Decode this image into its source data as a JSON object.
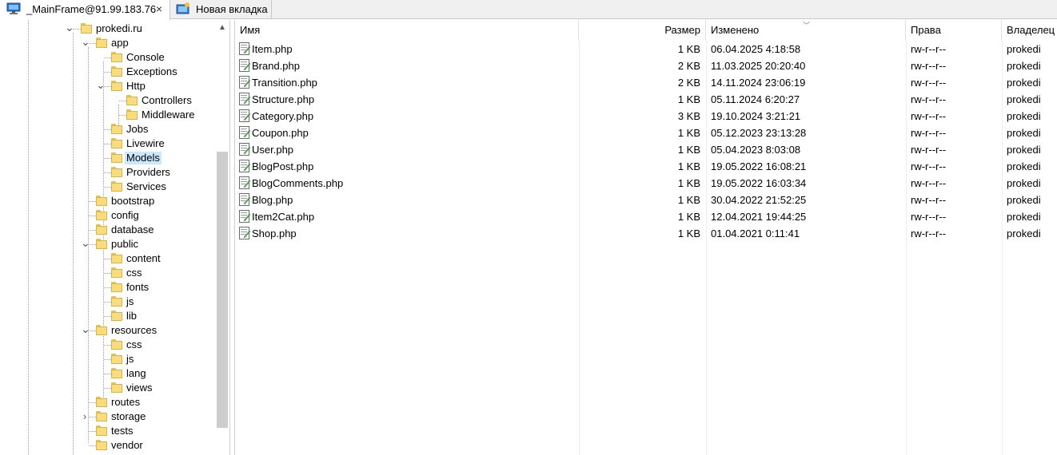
{
  "tabs": [
    {
      "title": "_MainFrame@91.99.183.76",
      "icon": "monitor-icon",
      "active": true,
      "close": "×"
    },
    {
      "title": "Новая вкладка",
      "icon": "new-tab-icon",
      "active": false
    }
  ],
  "tree": {
    "nodes": [
      {
        "label": "prokedi.ru",
        "depth": 0,
        "expander": "expanded"
      },
      {
        "label": "app",
        "depth": 1,
        "expander": "expanded"
      },
      {
        "label": "Console",
        "depth": 2,
        "expander": "none"
      },
      {
        "label": "Exceptions",
        "depth": 2,
        "expander": "none"
      },
      {
        "label": "Http",
        "depth": 2,
        "expander": "expanded"
      },
      {
        "label": "Controllers",
        "depth": 3,
        "expander": "none"
      },
      {
        "label": "Middleware",
        "depth": 3,
        "expander": "none"
      },
      {
        "label": "Jobs",
        "depth": 2,
        "expander": "none"
      },
      {
        "label": "Livewire",
        "depth": 2,
        "expander": "none"
      },
      {
        "label": "Models",
        "depth": 2,
        "expander": "none",
        "selected": true
      },
      {
        "label": "Providers",
        "depth": 2,
        "expander": "none"
      },
      {
        "label": "Services",
        "depth": 2,
        "expander": "none"
      },
      {
        "label": "bootstrap",
        "depth": 1,
        "expander": "none"
      },
      {
        "label": "config",
        "depth": 1,
        "expander": "none"
      },
      {
        "label": "database",
        "depth": 1,
        "expander": "none"
      },
      {
        "label": "public",
        "depth": 1,
        "expander": "expanded"
      },
      {
        "label": "content",
        "depth": 2,
        "expander": "none"
      },
      {
        "label": "css",
        "depth": 2,
        "expander": "none"
      },
      {
        "label": "fonts",
        "depth": 2,
        "expander": "none"
      },
      {
        "label": "js",
        "depth": 2,
        "expander": "none"
      },
      {
        "label": "lib",
        "depth": 2,
        "expander": "none"
      },
      {
        "label": "resources",
        "depth": 1,
        "expander": "expanded"
      },
      {
        "label": "css",
        "depth": 2,
        "expander": "none"
      },
      {
        "label": "js",
        "depth": 2,
        "expander": "none"
      },
      {
        "label": "lang",
        "depth": 2,
        "expander": "none"
      },
      {
        "label": "views",
        "depth": 2,
        "expander": "none"
      },
      {
        "label": "routes",
        "depth": 1,
        "expander": "none"
      },
      {
        "label": "storage",
        "depth": 1,
        "expander": "collapsed"
      },
      {
        "label": "tests",
        "depth": 1,
        "expander": "none"
      },
      {
        "label": "vendor",
        "depth": 1,
        "expander": "none"
      }
    ]
  },
  "list": {
    "columns": {
      "name": "Имя",
      "size": "Размер",
      "modified": "Изменено",
      "rights": "Права",
      "owner": "Владелец"
    },
    "files": [
      {
        "name": "Item.php",
        "size": "1 KB",
        "modified": "06.04.2025 4:18:58",
        "rights": "rw-r--r--",
        "owner": "prokedi"
      },
      {
        "name": "Brand.php",
        "size": "2 KB",
        "modified": "11.03.2025 20:20:40",
        "rights": "rw-r--r--",
        "owner": "prokedi"
      },
      {
        "name": "Transition.php",
        "size": "2 KB",
        "modified": "14.11.2024 23:06:19",
        "rights": "rw-r--r--",
        "owner": "prokedi"
      },
      {
        "name": "Structure.php",
        "size": "1 KB",
        "modified": "05.11.2024 6:20:27",
        "rights": "rw-r--r--",
        "owner": "prokedi"
      },
      {
        "name": "Category.php",
        "size": "3 KB",
        "modified": "19.10.2024 3:21:21",
        "rights": "rw-r--r--",
        "owner": "prokedi"
      },
      {
        "name": "Coupon.php",
        "size": "1 KB",
        "modified": "05.12.2023 23:13:28",
        "rights": "rw-r--r--",
        "owner": "prokedi"
      },
      {
        "name": "User.php",
        "size": "1 KB",
        "modified": "05.04.2023 8:03:08",
        "rights": "rw-r--r--",
        "owner": "prokedi"
      },
      {
        "name": "BlogPost.php",
        "size": "1 KB",
        "modified": "19.05.2022 16:08:21",
        "rights": "rw-r--r--",
        "owner": "prokedi"
      },
      {
        "name": "BlogComments.php",
        "size": "1 KB",
        "modified": "19.05.2022 16:03:34",
        "rights": "rw-r--r--",
        "owner": "prokedi"
      },
      {
        "name": "Blog.php",
        "size": "1 KB",
        "modified": "30.04.2022 21:52:25",
        "rights": "rw-r--r--",
        "owner": "prokedi"
      },
      {
        "name": "Item2Cat.php",
        "size": "1 KB",
        "modified": "12.04.2021 19:44:25",
        "rights": "rw-r--r--",
        "owner": "prokedi"
      },
      {
        "name": "Shop.php",
        "size": "1 KB",
        "modified": "01.04.2021 0:11:41",
        "rights": "rw-r--r--",
        "owner": "prokedi"
      }
    ]
  },
  "colors": {
    "selection": "#cce8ff",
    "folder": "#f9dd7d",
    "tabbar": "#f0f0f0"
  }
}
